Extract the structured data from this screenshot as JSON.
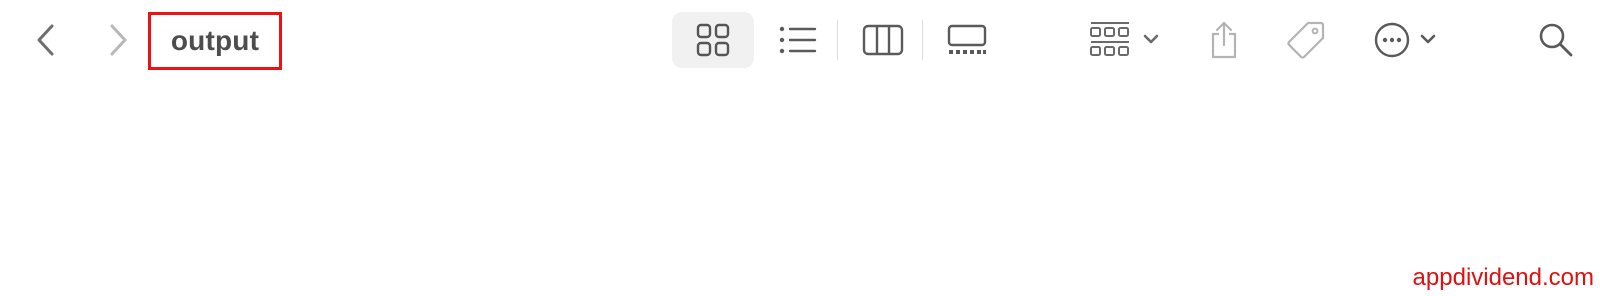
{
  "toolbar": {
    "back_icon": "chevron-left-icon",
    "forward_icon": "chevron-right-icon",
    "title": "output",
    "view_modes": {
      "icons": "icon-grid-view-icon",
      "list": "list-view-icon",
      "columns": "column-view-icon",
      "gallery": "gallery-view-icon",
      "selected": "icons"
    },
    "group_icon": "group-by-icon",
    "share_icon": "share-icon",
    "tag_icon": "tag-icon",
    "more_icon": "ellipsis-circle-icon",
    "search_icon": "search-icon"
  },
  "highlight_color": "#ee1111",
  "watermark": "appdividend.com"
}
